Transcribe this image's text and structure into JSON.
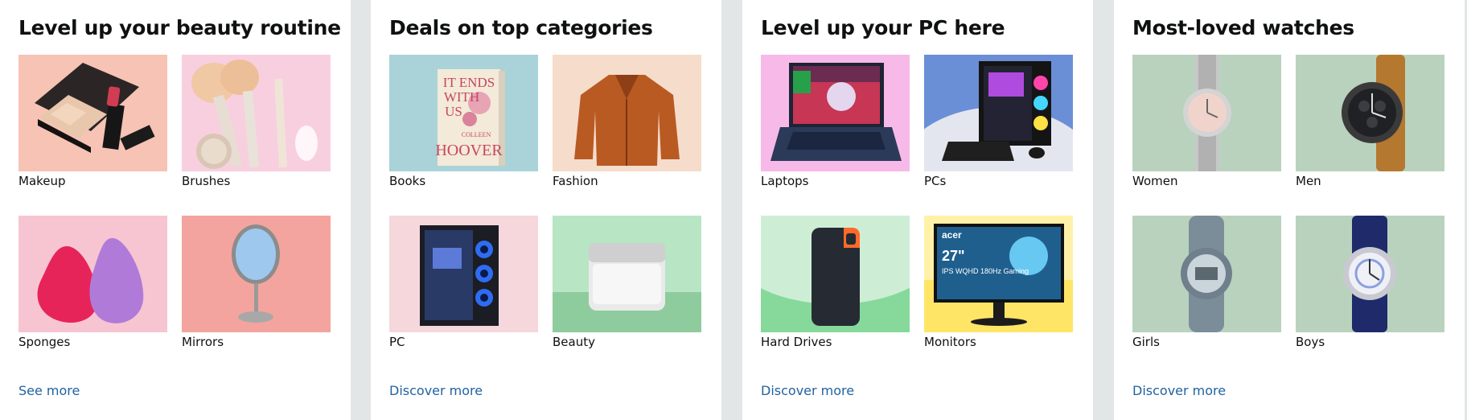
{
  "cards": [
    {
      "title": "Level up your beauty routine",
      "tiles": [
        {
          "label": "Makeup"
        },
        {
          "label": "Brushes"
        },
        {
          "label": "Sponges"
        },
        {
          "label": "Mirrors"
        }
      ],
      "link": "See more"
    },
    {
      "title": "Deals on top categories",
      "tiles": [
        {
          "label": "Books",
          "cover_text": [
            "IT ENDS",
            "WITH",
            "US",
            "COLLEEN",
            "HOOVER"
          ]
        },
        {
          "label": "Fashion"
        },
        {
          "label": "PC"
        },
        {
          "label": "Beauty"
        }
      ],
      "link": "Discover more"
    },
    {
      "title": "Level up your PC here",
      "tiles": [
        {
          "label": "Laptops"
        },
        {
          "label": "PCs"
        },
        {
          "label": "Hard Drives"
        },
        {
          "label": "Monitors",
          "screen_text": [
            "acer",
            "27\"",
            "IPS WQHD 180Hz Gaming"
          ]
        }
      ],
      "link": "Discover more"
    },
    {
      "title": "Most-loved watches",
      "tiles": [
        {
          "label": "Women"
        },
        {
          "label": "Men"
        },
        {
          "label": "Girls"
        },
        {
          "label": "Boys"
        }
      ],
      "link": "Discover more"
    }
  ],
  "colors": {
    "page_bg": "#e3e6e6",
    "card_bg": "#ffffff",
    "link": "#2162a1",
    "text": "#0f1111"
  }
}
